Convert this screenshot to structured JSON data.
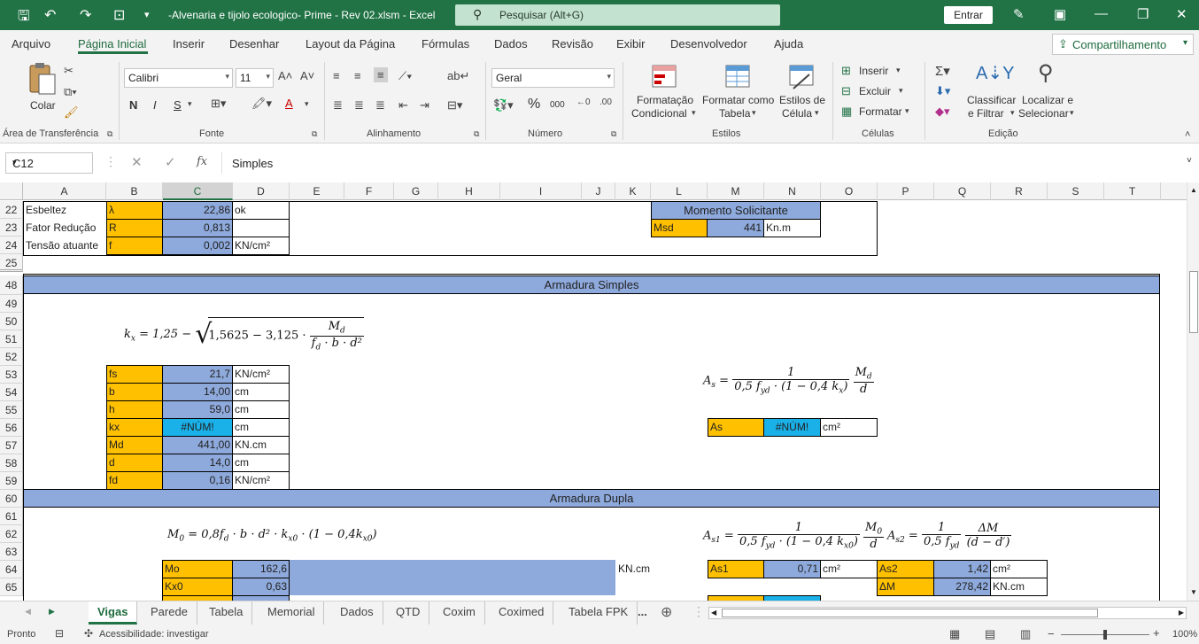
{
  "window": {
    "title": "-Alvenaria e tijolo ecologico- Prime - Rev 02.xlsm  -  Excel",
    "search_placeholder": "Pesquisar (Alt+G)",
    "signin_label": "Entrar"
  },
  "menu": {
    "tabs": [
      "Arquivo",
      "Página Inicial",
      "Inserir",
      "Desenhar",
      "Layout da Página",
      "Fórmulas",
      "Dados",
      "Revisão",
      "Exibir",
      "Desenvolvedor",
      "Ajuda"
    ],
    "active": "Página Inicial",
    "share_label": "Compartilhamento"
  },
  "ribbon": {
    "clipboard": {
      "paste_label": "Colar",
      "group_label": "Área de Transferência"
    },
    "font": {
      "family": "Calibri",
      "size": "11",
      "bold": "N",
      "italic": "I",
      "underline": "S",
      "group_label": "Fonte"
    },
    "alignment": {
      "group_label": "Alinhamento"
    },
    "number": {
      "format": "Geral",
      "group_label": "Número",
      "percent": "%",
      "thousands": "000"
    },
    "styles": {
      "conditional_1": "Formatação",
      "conditional_2": "Condicional",
      "table_1": "Formatar como",
      "table_2": "Tabela",
      "cell_1": "Estilos de",
      "cell_2": "Célula",
      "group_label": "Estilos"
    },
    "cells": {
      "insert": "Inserir",
      "delete": "Excluir",
      "format": "Formatar",
      "group_label": "Células"
    },
    "editing": {
      "sort_1": "Classificar",
      "sort_2": "e Filtrar",
      "find_1": "Localizar e",
      "find_2": "Selecionar",
      "group_label": "Edição"
    }
  },
  "formula_bar": {
    "name_box": "C12",
    "fx_label": "fx",
    "content": "Simples"
  },
  "columns": [
    "A",
    "B",
    "C",
    "D",
    "E",
    "F",
    "G",
    "H",
    "I",
    "J",
    "K",
    "L",
    "M",
    "N",
    "O",
    "P",
    "Q",
    "R",
    "S",
    "T"
  ],
  "selected_column": "C",
  "rows": [
    "22",
    "23",
    "24",
    "25",
    "48",
    "49",
    "50",
    "51",
    "52",
    "53",
    "54",
    "55",
    "56",
    "57",
    "58",
    "59",
    "60",
    "61",
    "62",
    "63",
    "64",
    "65"
  ],
  "sheet": {
    "top_block": [
      {
        "label": "Esbeltez",
        "sym": "λ",
        "value": "22,86",
        "unit": "ok"
      },
      {
        "label": "Fator  Redução",
        "sym": "R",
        "value": "0,813",
        "unit": ""
      },
      {
        "label": "Tensão atuante",
        "sym": "f",
        "value": "0,002",
        "unit": "KN/cm²"
      }
    ],
    "momento": {
      "header": "Momento Solicitante",
      "label": "Msd",
      "value": "441",
      "unit": "Kn.m"
    },
    "banner_simples": "Armadura Simples",
    "banner_dupla": "Armadura Dupla",
    "simples_inputs": [
      {
        "label": "fs",
        "value": "21,7",
        "unit": "KN/cm²"
      },
      {
        "label": "b",
        "value": "14,00",
        "unit": "cm"
      },
      {
        "label": "h",
        "value": "59,0",
        "unit": "cm"
      },
      {
        "label": "kx",
        "value": "#NÚM!",
        "unit": "cm"
      },
      {
        "label": "Md",
        "value": "441,00",
        "unit": "KN.cm"
      },
      {
        "label": "d",
        "value": "14,0",
        "unit": "cm"
      },
      {
        "label": "fd",
        "value": "0,16",
        "unit": "KN/cm²"
      }
    ],
    "as_row": {
      "label": "As",
      "value": "#NÚM!",
      "unit": "cm²"
    },
    "dupla_rows": [
      {
        "label": "Mo",
        "value": "162,6",
        "unit": "KN.cm"
      },
      {
        "label": "Kx0",
        "value": "0,63",
        "unit": ""
      }
    ],
    "as1": {
      "label": "As1",
      "value": "0,71",
      "unit": "cm²"
    },
    "as2": {
      "label": "As2",
      "value": "1,42",
      "unit": "cm²"
    },
    "dm": {
      "label": "ΔM",
      "value": "278,42",
      "unit": "KN.cm"
    }
  },
  "formulas": {
    "kx_lhs": "k",
    "kx_sub": "x",
    "kx_a": "= 1,25 −",
    "kx_b": "1,5625 − 3,125 ·",
    "kx_num": "M",
    "kx_num_sub": "d",
    "kx_den": "f",
    "kx_den_rest": "· b · d²",
    "kx_den_sub": "d",
    "as_lhs": "A",
    "as_lhs_sub": "s",
    "as_eq": "=",
    "as_num": "1",
    "as_den": "0,5 f",
    "as_den_sub": "yd",
    "as_den_rest": "· (1 − 0,4 k",
    "as_den_sub2": "x",
    "as_den_close": ")",
    "as_f2_num": "M",
    "as_f2_num_sub": "d",
    "as_f2_den": "d",
    "m0_text": "M",
    "m0_sub": "0",
    "m0_rest": "= 0,8f",
    "m0_rest_sub": "d",
    "m0_tail": "· b · d² · k",
    "m0_tail_sub": "x0",
    "m0_end": "· (1 − 0,4k",
    "m0_end_sub": "x0",
    "m0_close": ")",
    "as1_lhs": "A",
    "as1_sub": "s1",
    "as1_num": "1",
    "as1_den": "0,5 f",
    "as1_den_sub": "yd",
    "as1_den_rest": "· (1 − 0,4 k",
    "as1_den_sub2": "x0",
    "as1_den_close": ")",
    "as1_f2_num": "M",
    "as1_f2_num_sub": "0",
    "as1_f2_den": "d",
    "as2_lhs": "A",
    "as2_sub": "s2",
    "as2_num": "1",
    "as2_den": "0,5 f",
    "as2_den_sub": "yd",
    "as2_f2_num": "ΔM",
    "as2_f2_den": "(d − d′)"
  },
  "tabs": {
    "sheets": [
      "Vigas",
      "Parede",
      "Tabela",
      "Memorial",
      "Dados",
      "QTD",
      "Coxim",
      "Coximed",
      "Tabela FPK",
      "..."
    ],
    "active": "Vigas"
  },
  "status": {
    "ready": "Pronto",
    "accessibility": "Acessibilidade: investigar",
    "zoom": "100%"
  }
}
